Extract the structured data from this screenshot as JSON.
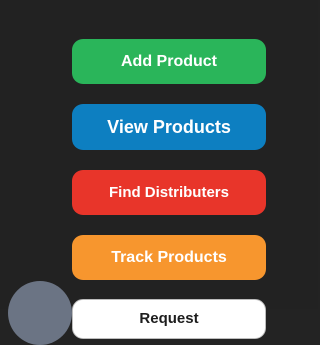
{
  "nav": {
    "add_product": {
      "label": "Add Product",
      "color": "#2ab55a"
    },
    "view_products": {
      "label": "View Products",
      "color": "#0d7fc1"
    },
    "find_distributers": {
      "label": "Find Distributers",
      "color": "#e8352a"
    },
    "track_products": {
      "label": "Track Products",
      "color": "#f7962e"
    },
    "request": {
      "label": "Request",
      "color": "#ffffff"
    }
  },
  "theme": {
    "background": "#222222",
    "avatar_color": "#6b7484"
  }
}
